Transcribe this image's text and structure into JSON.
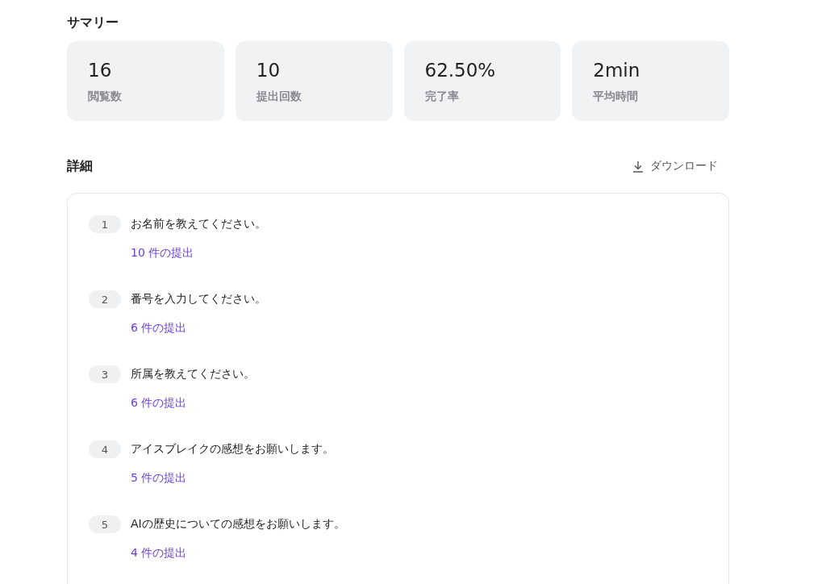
{
  "summary": {
    "title": "サマリー",
    "cards": [
      {
        "value": "16",
        "label": "閲覧数"
      },
      {
        "value": "10",
        "label": "提出回数"
      },
      {
        "value": "62.50%",
        "label": "完了率"
      },
      {
        "value": "2min",
        "label": "平均時間"
      }
    ]
  },
  "details": {
    "title": "詳細",
    "download": "ダウンロード",
    "questions": [
      {
        "number": "1",
        "text": "お名前を教えてください。",
        "submissions": "10 件の提出"
      },
      {
        "number": "2",
        "text": "番号を入力してください。",
        "submissions": "6 件の提出"
      },
      {
        "number": "3",
        "text": "所属を教えてください。",
        "submissions": "6 件の提出"
      },
      {
        "number": "4",
        "text": "アイスブレイクの感想をお願いします。",
        "submissions": "5 件の提出"
      },
      {
        "number": "5",
        "text": "AIの歴史についての感想をお願いします。",
        "submissions": "4 件の提出"
      }
    ]
  }
}
